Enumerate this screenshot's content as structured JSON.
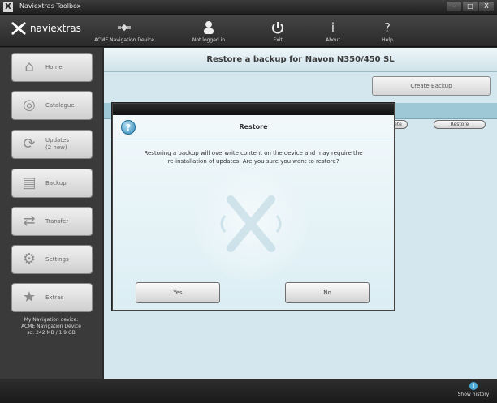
{
  "window": {
    "title": "Naviextras Toolbox",
    "app_icon": "X"
  },
  "window_controls": {
    "minimize": "–",
    "maximize": "□",
    "close": "X"
  },
  "toolbar": {
    "logo_text": "naviextras",
    "items": [
      {
        "label": "ACME Navigation Device",
        "icon": "satellite-icon"
      },
      {
        "label": "Not logged in",
        "icon": "user-icon"
      },
      {
        "label": "Exit",
        "icon": "power-icon"
      },
      {
        "label": "About",
        "icon": "info-icon"
      },
      {
        "label": "Help",
        "icon": "help-icon"
      }
    ]
  },
  "sidebar": {
    "items": [
      {
        "label": "Home",
        "icon": "home-icon"
      },
      {
        "label": "Catalogue",
        "icon": "catalogue-icon"
      },
      {
        "label": "Updates",
        "sublabel": "(2 new)",
        "icon": "updates-icon"
      },
      {
        "label": "Backup",
        "icon": "backup-icon"
      },
      {
        "label": "Transfer",
        "icon": "transfer-icon"
      },
      {
        "label": "Settings",
        "icon": "settings-icon"
      },
      {
        "label": "Extras",
        "icon": "star-icon"
      }
    ],
    "device_info": {
      "line1": "My Navigation device:",
      "line2": "ACME Navigation Device",
      "line3": "sd: 242 MB / 1.9 GB"
    }
  },
  "main": {
    "header": "Restore a backup for Navon N350/450 SL",
    "create_backup_label": "Create Backup",
    "row_buttons": {
      "delete_partial": "ete",
      "restore": "Restore"
    }
  },
  "dialog": {
    "title": "Restore",
    "icon": "question-icon",
    "message_line1": "Restoring a backup will overwrite content on the device and may require the",
    "message_line2": "re-installation of updates. Are you sure you want to restore?",
    "yes_label": "Yes",
    "no_label": "No"
  },
  "bottom": {
    "show_history_label": "Show history"
  },
  "colors": {
    "content_bg": "#d4e6ee",
    "table_header": "#9fc8d6",
    "accent": "#2f87b8",
    "sidebar_bg": "#3a3a3a"
  }
}
